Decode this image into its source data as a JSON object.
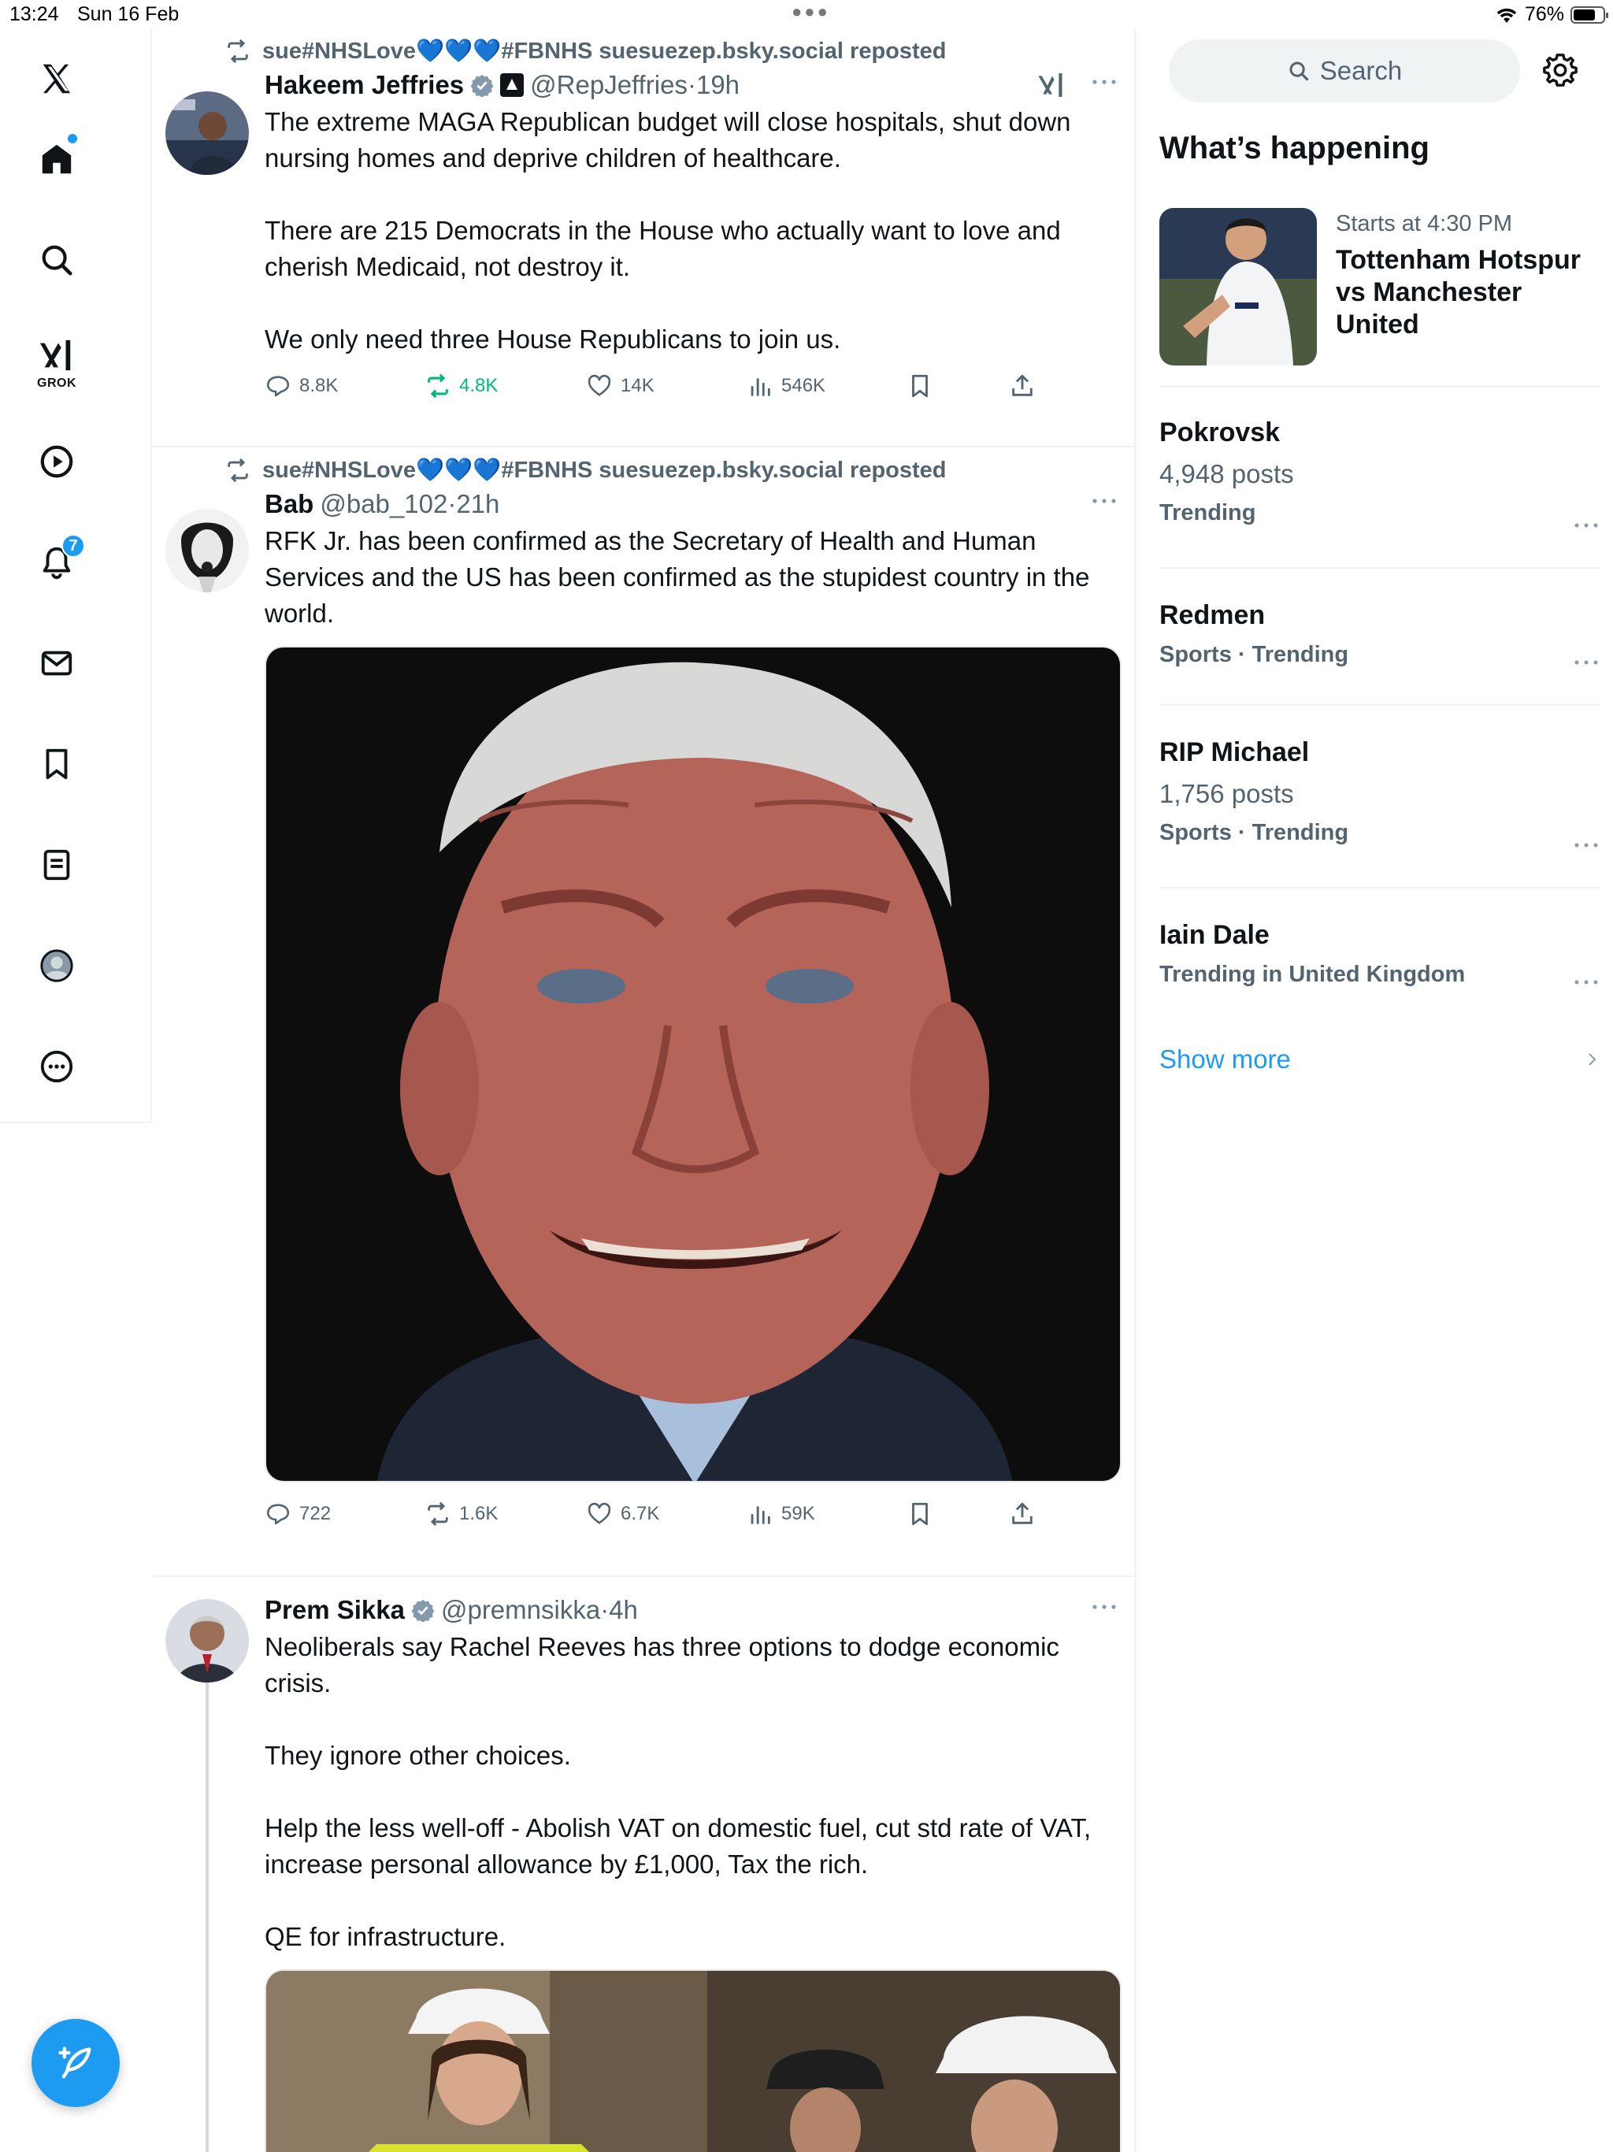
{
  "status_bar": {
    "time": "13:24",
    "date": "Sun 16 Feb",
    "battery": "76%",
    "battery_level": 0.76
  },
  "nav": {
    "notifications_count": "7",
    "grok_label": "GROK"
  },
  "posts": [
    {
      "repost_by": "sue#NHSLove💙💙💙#FBNHS suesuezep.bsky.social reposted",
      "name": "Hakeem Jeffries",
      "handle": "@RepJeffries",
      "sep": " · ",
      "time": "19h",
      "text": "The extreme MAGA Republican budget will close hospitals, shut down nursing homes and deprive children of healthcare.\n\nThere are 215 Democrats in the House who actually want to love and cherish Medicaid, not destroy it.\n\nWe only need three House Republicans to join us.",
      "stats": {
        "replies": "8.8K",
        "reposts": "4.8K",
        "likes": "14K",
        "views": "546K"
      }
    },
    {
      "repost_by": "sue#NHSLove💙💙💙#FBNHS suesuezep.bsky.social reposted",
      "name": "Bab",
      "handle": "@bab_102",
      "sep": " · ",
      "time": "21h",
      "text": "RFK Jr. has been confirmed as the Secretary of Health and Human Services and the US has been confirmed as the stupidest country in the world.",
      "stats": {
        "replies": "722",
        "reposts": "1.6K",
        "likes": "6.7K",
        "views": "59K"
      }
    },
    {
      "name": "Prem Sikka",
      "handle": "@premnsikka",
      "sep": " · ",
      "time": "4h",
      "text": "Neoliberals say Rachel Reeves has three options to dodge economic crisis.\n\nThey ignore other choices.\n\nHelp the less well-off - Abolish VAT on domestic fuel, cut std rate of VAT, increase personal allowance by £1,000, Tax the rich.\n\nQE for infrastructure."
    }
  ],
  "sidebar": {
    "search_placeholder": "Search",
    "section_title": "What’s happening",
    "event": {
      "meta": "Starts at 4:30 PM",
      "title": "Tottenham Hotspur vs Manchester United"
    },
    "trends": [
      {
        "name": "Pokrovsk",
        "posts": "4,948 posts",
        "meta": "Trending"
      },
      {
        "name": "Redmen",
        "posts": "",
        "meta": "Sports · Trending"
      },
      {
        "name": "RIP Michael",
        "posts": "1,756 posts",
        "meta": "Sports · Trending"
      },
      {
        "name": "Iain Dale",
        "posts": "",
        "meta": "Trending in United Kingdom"
      }
    ],
    "show_more": "Show more"
  },
  "colors": {
    "accent": "#1d9bf0",
    "repost_green": "#00ba7c",
    "secondary_text": "#536471"
  }
}
